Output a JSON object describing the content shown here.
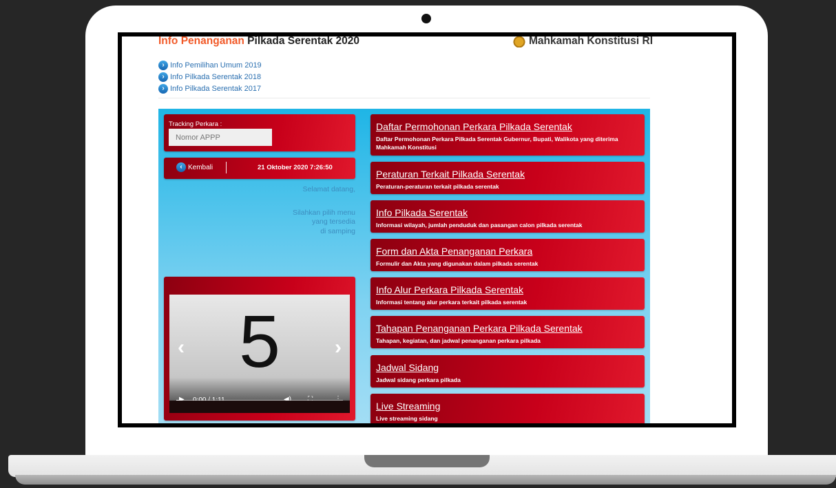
{
  "header": {
    "title_accent": "Info Penanganan",
    "title_rest": " Pilkada Serentak 2020",
    "institution": "Mahkamah Konstitusi RI"
  },
  "links": [
    {
      "label": "Info Pemilihan Umum 2019"
    },
    {
      "label": "Info Pilkada Serentak 2018"
    },
    {
      "label": "Info Pilkada Serentak 2017"
    }
  ],
  "tracking": {
    "label": "Tracking Perkara :",
    "placeholder": "Nomor APPP"
  },
  "nav": {
    "back_label": "Kembali",
    "datetime": "21 Oktober 2020 7:26:50"
  },
  "welcome": {
    "line1": "Selamat datang,",
    "line2": "Silahkan pilih menu",
    "line3": "yang tersedia",
    "line4": "di samping"
  },
  "video": {
    "slide_number": "5",
    "time": "0:00 / 1:11",
    "progress": 0.0
  },
  "menu": [
    {
      "title": "Daftar Permohonan Perkara Pilkada Serentak",
      "desc": "Daftar Permohonan Perkara Pilkada Serentak Gubernur, Bupati, Walikota yang diterima Mahkamah Konstitusi"
    },
    {
      "title": "Peraturan Terkait Pilkada Serentak",
      "desc": "Peraturan-peraturan terkait pilkada serentak"
    },
    {
      "title": "Info Pilkada Serentak",
      "desc": "Informasi wilayah, jumlah penduduk dan pasangan calon pilkada serentak"
    },
    {
      "title": "Form dan Akta Penanganan Perkara",
      "desc": "Formulir dan Akta yang digunakan dalam pilkada serentak"
    },
    {
      "title": "Info Alur Perkara Pilkada Serentak",
      "desc": "Informasi tentang alur perkara terkait pilkada serentak"
    },
    {
      "title": "Tahapan Penanganan Perkara Pilkada Serentak",
      "desc": "Tahapan, kegiatan, dan jadwal penanganan perkara pilkada"
    },
    {
      "title": "Jadwal Sidang",
      "desc": "Jadwal sidang perkara pilkada"
    },
    {
      "title": "Live Streaming",
      "desc": "Live streaming sidang"
    }
  ],
  "colors": {
    "accent": "#f15a29",
    "menu_red": "#c8001a",
    "panel_blue": "#1fb5e6"
  }
}
